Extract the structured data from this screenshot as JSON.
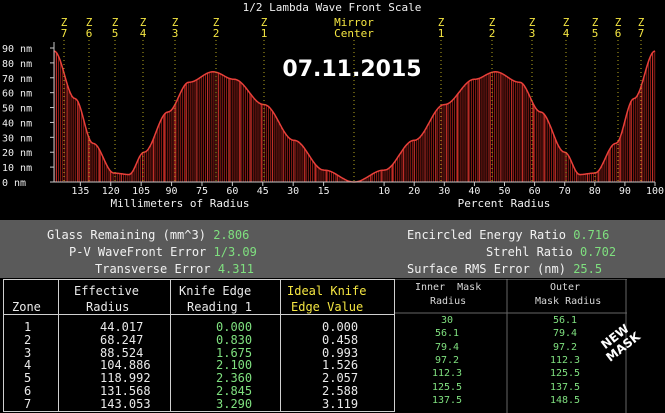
{
  "chart_data": {
    "type": "line",
    "title": "1/2 Lambda Wave Front Scale",
    "date_label": "07.11.2015",
    "ylabel_unit": "nm",
    "y_ticks": [
      "90 nm",
      "80 nm",
      "70 nm",
      "60 nm",
      "50 nm",
      "40 nm",
      "30 nm",
      "20 nm",
      "10 nm",
      "0 nm"
    ],
    "ylim": [
      0,
      90
    ],
    "left_panel": {
      "xlabel": "Millimeters of Radius",
      "x_ticks": [
        "135",
        "120",
        "105",
        "90",
        "75",
        "60",
        "45",
        "30",
        "15"
      ],
      "x_tick_values": [
        135,
        120,
        105,
        90,
        75,
        60,
        45,
        30,
        15
      ],
      "x_range": [
        148,
        0
      ]
    },
    "right_panel": {
      "xlabel": "Percent Radius",
      "x_ticks": [
        "10",
        "20",
        "30",
        "40",
        "50",
        "60",
        "70",
        "80",
        "90",
        "100"
      ],
      "x_tick_values": [
        10,
        20,
        30,
        40,
        50,
        60,
        70,
        80,
        90,
        100
      ],
      "x_range": [
        0,
        100
      ]
    },
    "center_label": [
      "Mirror",
      "Center"
    ],
    "zone_labels_left": [
      [
        "Z",
        "7"
      ],
      [
        "Z",
        "6"
      ],
      [
        "Z",
        "5"
      ],
      [
        "Z",
        "4"
      ],
      [
        "Z",
        "3"
      ],
      [
        "Z",
        "2"
      ],
      [
        "Z",
        "1"
      ]
    ],
    "zone_labels_right": [
      [
        "Z",
        "1"
      ],
      [
        "Z",
        "2"
      ],
      [
        "Z",
        "3"
      ],
      [
        "Z",
        "4"
      ],
      [
        "Z",
        "5"
      ],
      [
        "Z",
        "6"
      ],
      [
        "Z",
        "7"
      ]
    ],
    "series": [
      {
        "percent_radius": [
          0,
          10,
          20,
          30,
          40,
          47,
          55,
          62,
          70,
          75,
          80,
          87,
          93,
          100
        ],
        "values": [
          0,
          8,
          28,
          52,
          69,
          74,
          67,
          47,
          20,
          5,
          6,
          26,
          56,
          88
        ]
      }
    ],
    "colors": {
      "curve": "#e8403a",
      "fill": "#8a1c16",
      "zone_marker": "#f5e642",
      "axis": "#c8c8c8"
    }
  },
  "stats": {
    "glass_remaining_label": "Glass Remaining (mm^3)",
    "glass_remaining_value": "2.806",
    "pv_error_label": "P-V WaveFront Error",
    "pv_error_value": "1/3.09",
    "transverse_error_label": "Transverse Error",
    "transverse_error_value": "4.311",
    "encircled_energy_label": "Encircled Energy Ratio",
    "encircled_energy_value": "0.716",
    "strehl_label": "Strehl Ratio",
    "strehl_value": "0.702",
    "rms_error_label": "Surface RMS Error (nm)",
    "rms_error_value": "25.5"
  },
  "zone_table": {
    "headers": {
      "zone": "Zone",
      "effective_radius": [
        "Effective",
        "Radius"
      ],
      "knife_edge": [
        "Knife Edge",
        "Reading 1"
      ],
      "ideal_knife": [
        "Ideal Knife",
        "Edge Value"
      ]
    },
    "rows": [
      {
        "zone": "1",
        "effective_radius": "44.017",
        "knife_edge": "0.000",
        "ideal": "0.000"
      },
      {
        "zone": "2",
        "effective_radius": "68.247",
        "knife_edge": "0.830",
        "ideal": "0.458"
      },
      {
        "zone": "3",
        "effective_radius": "88.524",
        "knife_edge": "1.675",
        "ideal": "0.993"
      },
      {
        "zone": "4",
        "effective_radius": "104.886",
        "knife_edge": "2.100",
        "ideal": "1.526"
      },
      {
        "zone": "5",
        "effective_radius": "118.992",
        "knife_edge": "2.360",
        "ideal": "2.057"
      },
      {
        "zone": "6",
        "effective_radius": "131.568",
        "knife_edge": "2.845",
        "ideal": "2.588"
      },
      {
        "zone": "7",
        "effective_radius": "143.053",
        "knife_edge": "3.290",
        "ideal": "3.119"
      }
    ]
  },
  "mask_table": {
    "headers": {
      "inner": [
        "Inner  Mask",
        "Radius"
      ],
      "outer": [
        "Outer",
        "Mask Radius"
      ]
    },
    "rows": [
      {
        "inner": "30",
        "outer": "56.1"
      },
      {
        "inner": "56.1",
        "outer": "79.4"
      },
      {
        "inner": "79.4",
        "outer": "97.2"
      },
      {
        "inner": "97.2",
        "outer": "112.3"
      },
      {
        "inner": "112.3",
        "outer": "125.5"
      },
      {
        "inner": "125.5",
        "outer": "137.5"
      },
      {
        "inner": "137.5",
        "outer": "148.5"
      }
    ],
    "badge": [
      "NEW",
      "MASK"
    ]
  }
}
